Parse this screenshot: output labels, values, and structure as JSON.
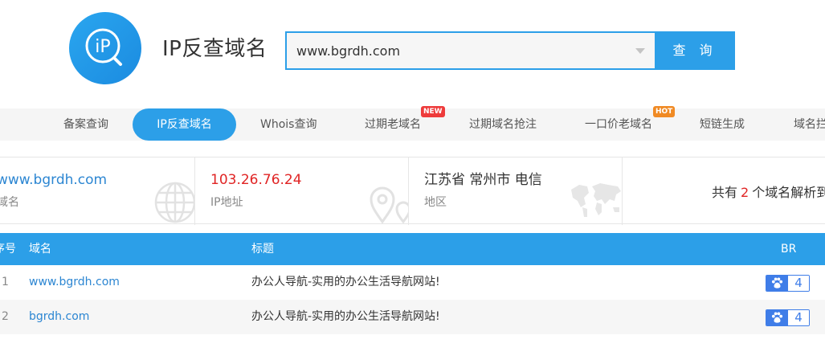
{
  "header": {
    "logo_text": "iP",
    "site_title": "IP反查域名",
    "search": {
      "value": "www.bgrdh.com",
      "placeholder": ""
    },
    "search_button": "查 询"
  },
  "nav": {
    "items": [
      {
        "label": "备案查询"
      },
      {
        "label": "IP反查域名",
        "active": true
      },
      {
        "label": "Whois查询"
      },
      {
        "label": "过期老域名",
        "badge": "NEW"
      },
      {
        "label": "过期域名抢注"
      },
      {
        "label": "一口价老域名",
        "badge": "HOT"
      },
      {
        "label": "短链生成"
      },
      {
        "label": "域名拦"
      }
    ]
  },
  "info": {
    "domain": {
      "value": "www.bgrdh.com",
      "label": "域名"
    },
    "ip": {
      "value": "103.26.76.24",
      "label": "IP地址"
    },
    "region": {
      "value": "江苏省 常州市 电信",
      "label": "地区"
    },
    "summary": {
      "prefix": "共有",
      "count": "2",
      "suffix": "个域名解析到"
    }
  },
  "table": {
    "headers": {
      "index": "序号",
      "domain": "域名",
      "title": "标题",
      "br": "BR"
    },
    "rows": [
      {
        "index": "1",
        "domain": "www.bgrdh.com",
        "title": "办公人导航-实用的办公生活导航网站!",
        "br": "4"
      },
      {
        "index": "2",
        "domain": "bgrdh.com",
        "title": "办公人导航-实用的办公生活导航网站!",
        "br": "4"
      }
    ]
  },
  "colors": {
    "accent": "#2c9fe8",
    "highlight": "#e02424",
    "link": "#2c86d2",
    "br_badge": "#3f7de8"
  }
}
